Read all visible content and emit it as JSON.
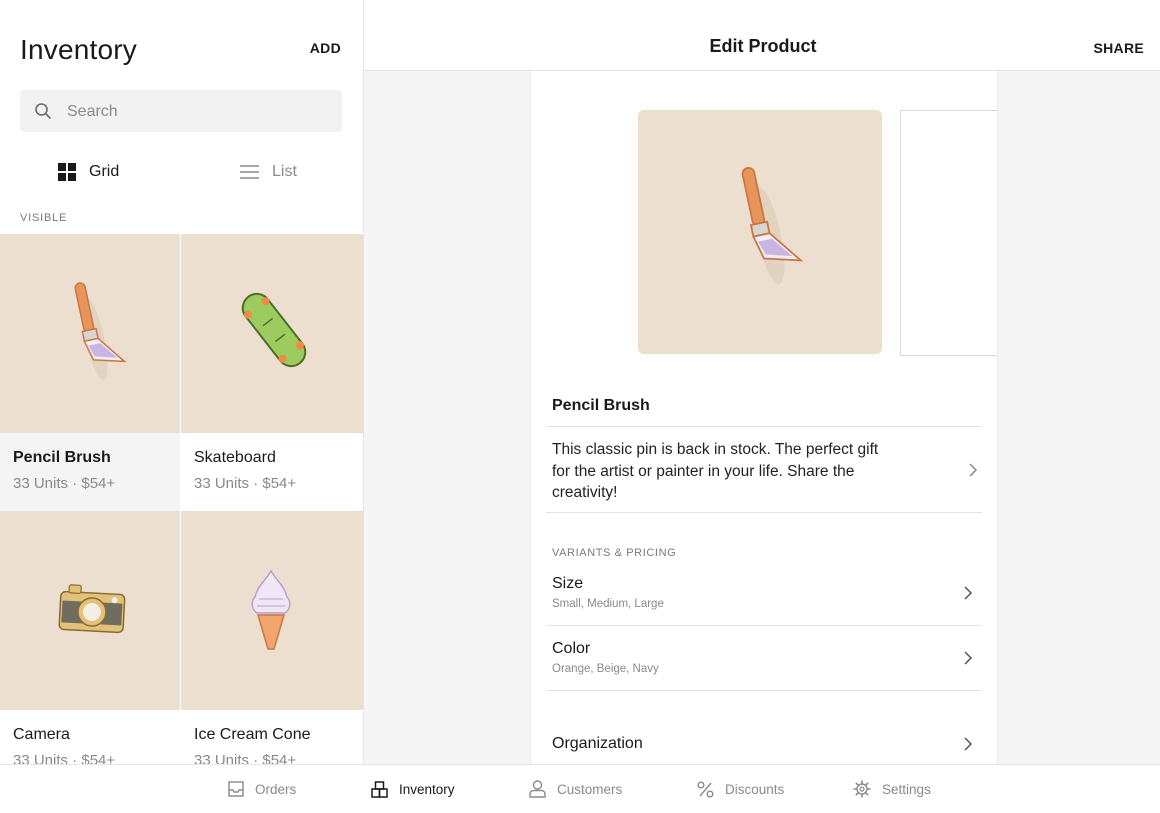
{
  "inventory": {
    "title": "Inventory",
    "add_label": "ADD",
    "search": {
      "placeholder": "Search"
    },
    "view_toggle": {
      "grid_label": "Grid",
      "list_label": "List",
      "selected": "Grid"
    },
    "section_label": "VISIBLE",
    "items": [
      {
        "name": "Pencil Brush",
        "subtitle": "33 Units · $54+",
        "icon": "paintbrush-pin",
        "selected": true
      },
      {
        "name": "Skateboard",
        "subtitle": "33 Units · $54+",
        "icon": "skateboard-pin",
        "selected": false
      },
      {
        "name": "Camera",
        "subtitle": "33 Units · $54+",
        "icon": "camera-pin",
        "selected": false
      },
      {
        "name": "Ice Cream Cone",
        "subtitle": "33 Units · $54+",
        "icon": "ice-cream-pin",
        "selected": false
      }
    ]
  },
  "edit_product": {
    "title": "Edit Product",
    "share_label": "SHARE",
    "product_name": "Pencil Brush",
    "description": "This classic pin is back in stock. The perfect gift for the artist or painter in your life. Share the creativity!",
    "variants_label": "VARIANTS & PRICING",
    "variants": [
      {
        "title": "Size",
        "subtitle": "Small, Medium, Large"
      },
      {
        "title": "Color",
        "subtitle": "Orange, Beige, Navy"
      }
    ],
    "organization_label": "Organization"
  },
  "tabbar": {
    "items": [
      {
        "label": "Orders",
        "icon": "tray-icon"
      },
      {
        "label": "Inventory",
        "icon": "inventory-icon",
        "active": true
      },
      {
        "label": "Customers",
        "icon": "person-icon"
      },
      {
        "label": "Discounts",
        "icon": "percent-icon"
      },
      {
        "label": "Settings",
        "icon": "gear-icon"
      }
    ]
  },
  "colors": {
    "tile_background": "#ecdfcf",
    "panel_background": "#f5f5f5",
    "text_primary": "#1a1a1a",
    "text_muted": "#8a8a8a"
  }
}
